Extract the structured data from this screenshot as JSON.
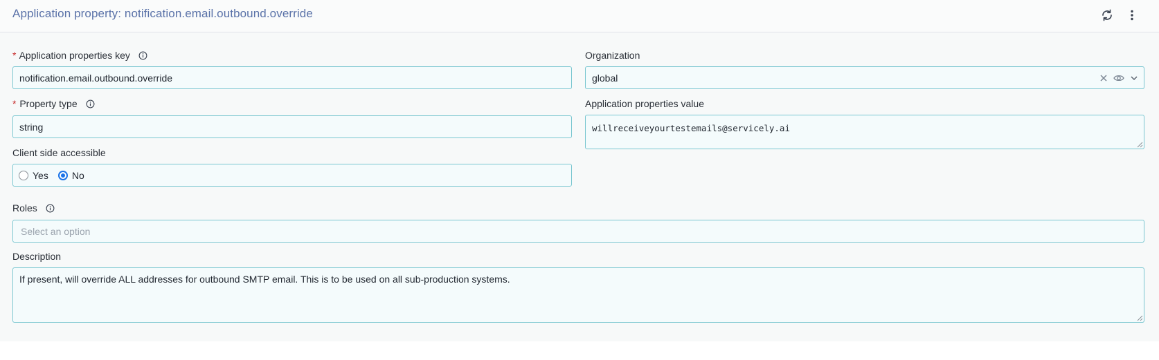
{
  "header": {
    "title": "Application property: notification.email.outbound.override",
    "refresh_icon": "refresh-icon",
    "more_icon": "kebab-menu-icon"
  },
  "form": {
    "key": {
      "label": "Application properties key",
      "required": "*",
      "value": "notification.email.outbound.override"
    },
    "organization": {
      "label": "Organization",
      "value": "global"
    },
    "property_type": {
      "label": "Property type",
      "required": "*",
      "value": "string"
    },
    "property_value": {
      "label": "Application properties value",
      "value": "willreceiveyourtestemails@servicely.ai"
    },
    "client_side": {
      "label": "Client side accessible",
      "options": [
        "Yes",
        "No"
      ],
      "selected": "No"
    },
    "roles": {
      "label": "Roles",
      "placeholder": "Select an option"
    },
    "description": {
      "label": "Description",
      "value": "If present, will override ALL addresses for outbound SMTP email. This is to be used on all sub-production systems."
    }
  },
  "colors": {
    "title": "#5a72a8",
    "field_border": "#79c6d0",
    "field_bg": "#f4fbfc",
    "required": "#c62828",
    "radio_accent": "#1a73e8"
  }
}
